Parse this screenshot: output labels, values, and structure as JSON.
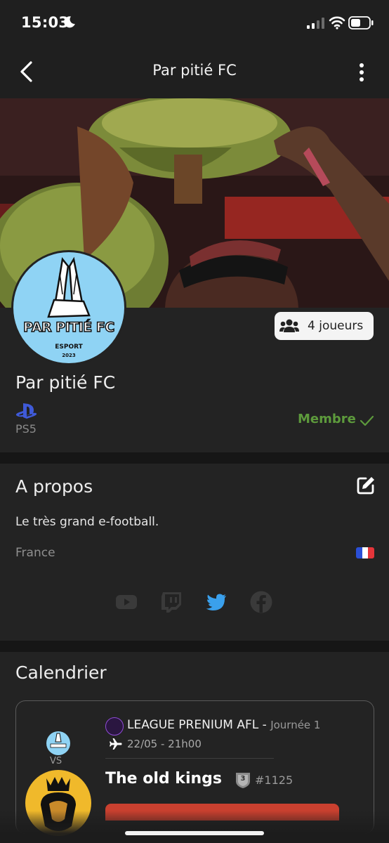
{
  "status_bar": {
    "time": "15:03"
  },
  "nav": {
    "title": "Par pitié FC"
  },
  "team": {
    "logo_text": "PAR PITIÉ FC",
    "logo_subtext": "ESPORT",
    "logo_year": "2023",
    "name": "Par pitié FC",
    "players_count": "4 joueurs",
    "platform": "PS5",
    "membership": "Membre"
  },
  "about": {
    "title": "A propos",
    "description": "Le très grand e-football.",
    "country": "France",
    "flag_colors": [
      "#2a4fd6",
      "#ffffff",
      "#e5353a"
    ],
    "socials": [
      {
        "name": "youtube-icon",
        "active": false
      },
      {
        "name": "twitch-icon",
        "active": false
      },
      {
        "name": "twitter-icon",
        "active": true,
        "color": "#3aa0ec"
      },
      {
        "name": "facebook-icon",
        "active": false
      }
    ]
  },
  "calendar": {
    "title": "Calendrier",
    "match": {
      "vs_label": "VS",
      "league_name": "LEAGUE PRENIUM AFL",
      "league_separator": " - ",
      "round": "Journée 1",
      "date": "22/05 - 21h00",
      "opponent": "The old kings",
      "rank_level": "3",
      "rank_number": "#1125"
    }
  },
  "colors": {
    "background": "#1b1b1b",
    "card": "#232323",
    "member_green": "#5d9a3c",
    "twitter_blue": "#3aa0ec",
    "action_red": "#c9402f"
  }
}
